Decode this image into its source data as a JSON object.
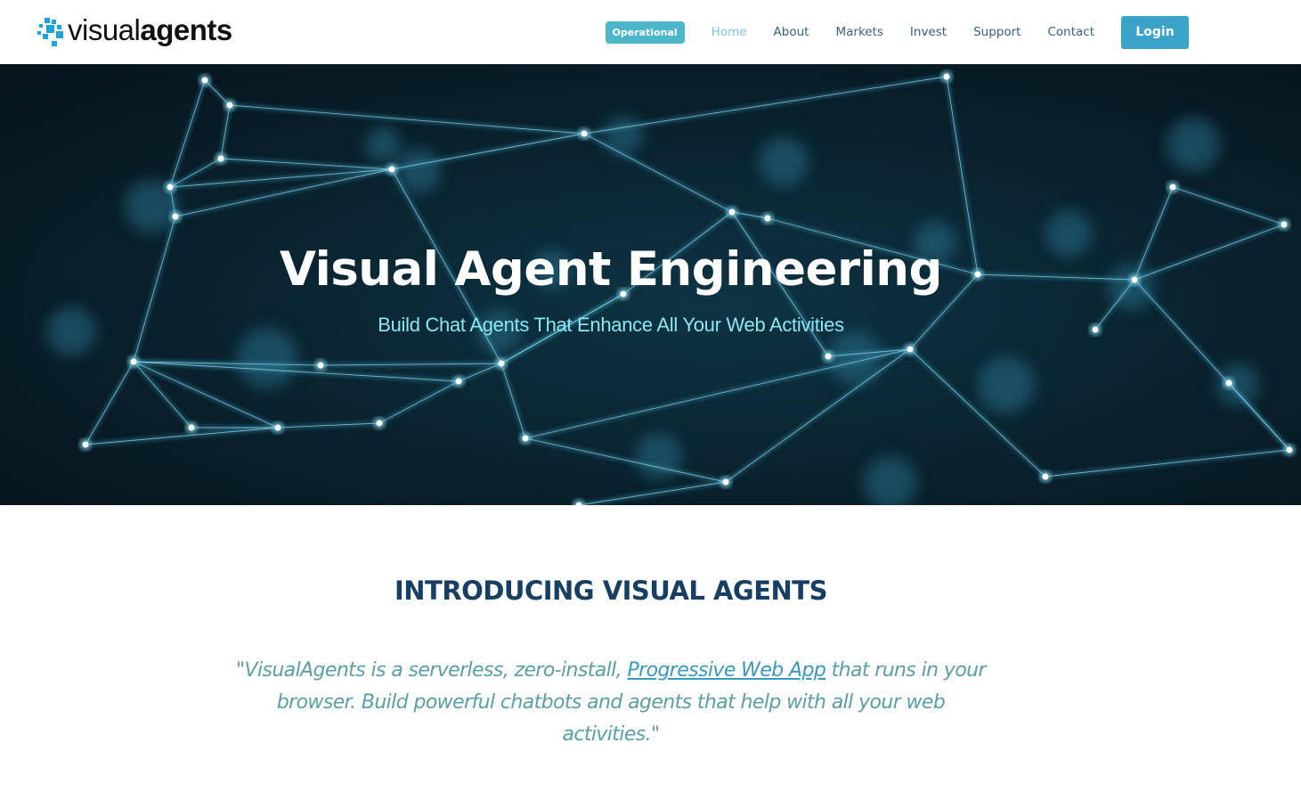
{
  "brand": {
    "name_light": "visual",
    "name_bold": "agents",
    "icon": "pixel-squares-logo-icon",
    "color": "#1ea1dc"
  },
  "nav": {
    "status_badge": "Operational",
    "items": [
      {
        "label": "Home",
        "active": true
      },
      {
        "label": "About",
        "active": false
      },
      {
        "label": "Markets",
        "active": false
      },
      {
        "label": "Invest",
        "active": false
      },
      {
        "label": "Support",
        "active": false
      },
      {
        "label": "Contact",
        "active": false
      }
    ],
    "login_label": "Login"
  },
  "hero": {
    "title": "Visual Agent Engineering",
    "subtitle": "Build Chat Agents That Enhance All Your Web Activities",
    "background": "network-nodes-illustration"
  },
  "intro": {
    "heading": "INTRODUCING VISUAL AGENTS",
    "quote_before": "\"VisualAgents is a serverless, zero-install, ",
    "quote_link": "Progressive Web App",
    "quote_after": " that runs in your browser. Build powerful chatbots and agents that help with all your web activities.\""
  },
  "colors": {
    "accent": "#3ba3c8",
    "badge": "#4db7c9",
    "nav_text": "#3c5f7d",
    "nav_active": "#7fc3d8",
    "heading": "#173f63",
    "quote": "#5b9ea3",
    "hero_subtitle": "#8be6f2"
  }
}
